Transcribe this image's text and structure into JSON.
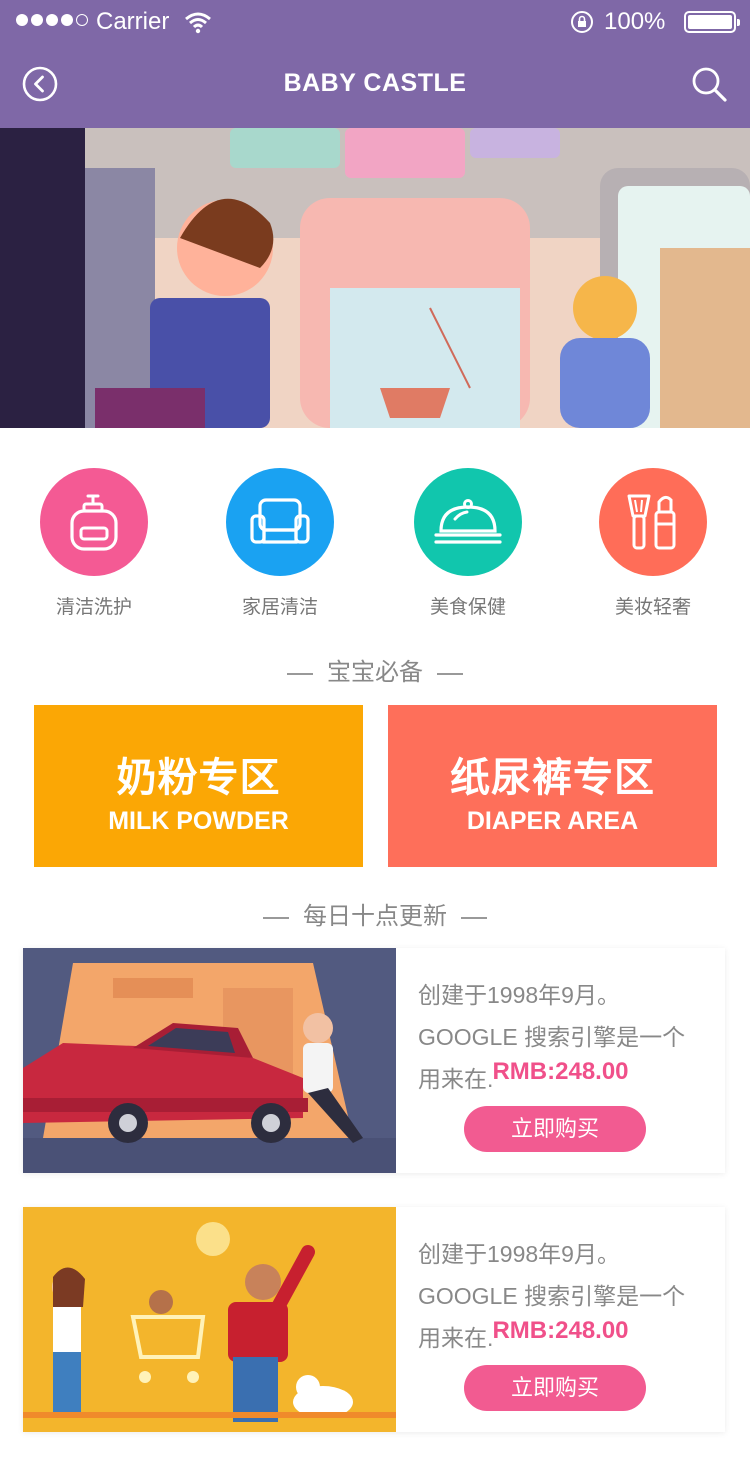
{
  "status_bar": {
    "carrier": "Carrier",
    "battery": "100%"
  },
  "header": {
    "title": "BABY CASTLE"
  },
  "categories": [
    {
      "label": "清洁洗护",
      "color": "#f45a94",
      "icon": "baby-bottle-icon"
    },
    {
      "label": "家居清洁",
      "color": "#1aa2f2",
      "icon": "sofa-icon"
    },
    {
      "label": "美食保健",
      "color": "#11c6ad",
      "icon": "food-cloche-icon"
    },
    {
      "label": "美妆轻奢",
      "color": "#ff6d58",
      "icon": "makeup-icon"
    }
  ],
  "section_essentials": "宝宝必备",
  "zones": [
    {
      "cn": "奶粉专区",
      "en": "MILK POWDER",
      "color": "#fba705"
    },
    {
      "cn": "纸尿裤专区",
      "en": "DIAPER AREA",
      "color": "#fe6f5a"
    }
  ],
  "section_daily": "每日十点更新",
  "products": [
    {
      "desc": "创建于1998年9月。GOOGLE 搜索引擎是一个用来在.",
      "price": "RMB:248.00",
      "buy": "立即购买"
    },
    {
      "desc": "创建于1998年9月。GOOGLE 搜索引擎是一个用来在.",
      "price": "RMB:248.00",
      "buy": "立即购买"
    }
  ]
}
